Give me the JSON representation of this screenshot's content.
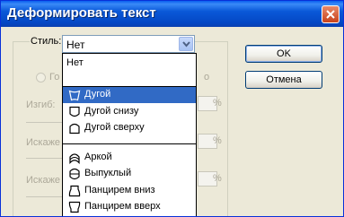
{
  "window": {
    "title": "Деформировать текст"
  },
  "style_field": {
    "label": "Стиль:",
    "value": "Нет"
  },
  "background_controls": {
    "radio_left_fragment": "Го",
    "radio_right_fragment": "о",
    "bend_label": "Изгиб:",
    "distortion_label": "Искаже",
    "percent": "%"
  },
  "dropdown": {
    "none_item": "Нет",
    "group1": [
      {
        "label": "Дугой",
        "icon": "arc-icon",
        "selected": true
      },
      {
        "label": "Дугой снизу",
        "icon": "arc-lower-icon",
        "selected": false
      },
      {
        "label": "Дугой сверху",
        "icon": "arc-upper-icon",
        "selected": false
      }
    ],
    "group2": [
      {
        "label": "Аркой",
        "icon": "arch-icon",
        "selected": false
      },
      {
        "label": "Выпуклый",
        "icon": "bulge-icon",
        "selected": false
      },
      {
        "label": "Панцирем вниз",
        "icon": "shell-lower-icon",
        "selected": false
      },
      {
        "label": "Панцирем вверх",
        "icon": "shell-upper-icon",
        "selected": false
      }
    ]
  },
  "buttons": {
    "ok": "OK",
    "cancel": "Отмена"
  }
}
